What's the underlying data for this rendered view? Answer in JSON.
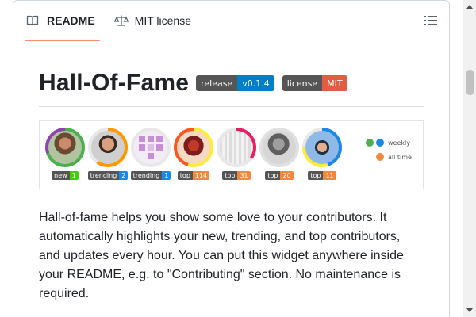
{
  "tabs": [
    {
      "label": "README",
      "icon": "book-icon",
      "active": true
    },
    {
      "label": "MIT license",
      "icon": "scale-icon",
      "active": false
    }
  ],
  "readme": {
    "title": "Hall-Of-Fame",
    "badges": [
      {
        "left": "release",
        "right": "v0.1.4",
        "color": "#007ec6"
      },
      {
        "left": "license",
        "right": "MIT",
        "color": "#e05d44"
      }
    ],
    "widget": {
      "avatars": [
        {
          "key": "new",
          "value": "1"
        },
        {
          "key": "trending",
          "value": "2"
        },
        {
          "key": "trending",
          "value": "1"
        },
        {
          "key": "top",
          "value": "114"
        },
        {
          "key": "top",
          "value": "31"
        },
        {
          "key": "top",
          "value": "20"
        },
        {
          "key": "top",
          "value": "11"
        }
      ],
      "legend": {
        "weekly": "weekly",
        "all_time": "all time"
      }
    },
    "description": "Hall-of-fame helps you show some love to your contributors. It automatically highlights your new, trending, and top contributors, and updates every hour. You can put this widget anywhere inside your README, e.g. to \"Contributing\" section. No maintenance is required."
  },
  "colors": {
    "accent": "#fd8c73",
    "new": "#4c1",
    "trending": "#1e88e5",
    "top": "#f0883e"
  }
}
